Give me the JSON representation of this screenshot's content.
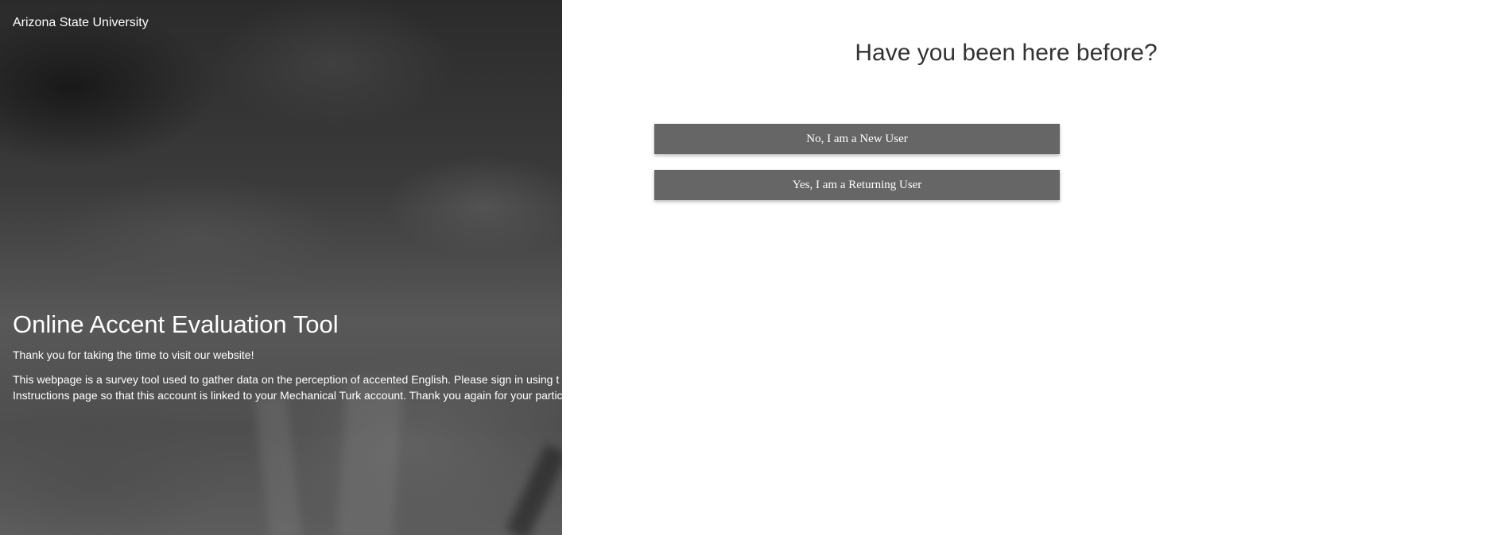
{
  "hero": {
    "brand": "Arizona State University",
    "title": "Online Accent Evaluation Tool",
    "thanks": "Thank you for taking the time to visit our website!",
    "description_line1": "This webpage is a survey tool used to gather data on the perception of accented English. Please sign in using t",
    "description_line2": "Instructions page so that this account is linked to your Mechanical Turk account. Thank you again for your partic"
  },
  "panel": {
    "question": "Have you been here before?",
    "new_user_label": "No, I am a New User",
    "returning_user_label": "Yes, I am a Returning User"
  },
  "colors": {
    "button_bg": "#666666",
    "question_text": "#333333",
    "panel_bg": "#ffffff"
  }
}
